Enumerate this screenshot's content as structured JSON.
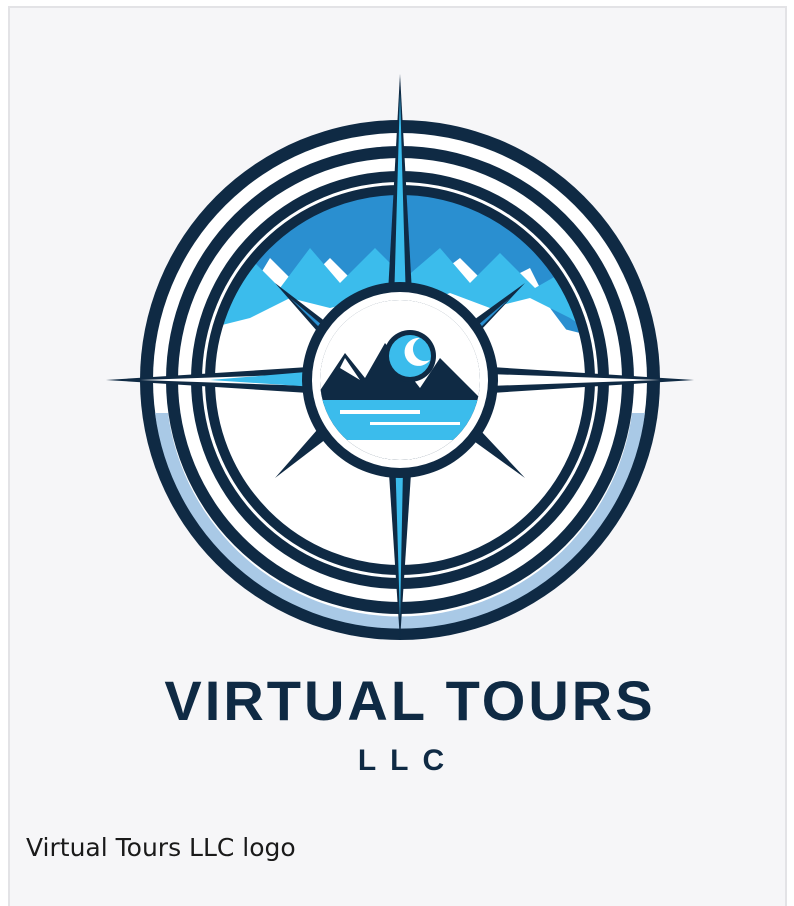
{
  "logo": {
    "name_line1": "VIRTUAL TOURS",
    "name_line2": "LLC",
    "colors": {
      "navy": "#0f2a44",
      "sky": "#3bbcec",
      "blue": "#2a8fd0",
      "light_blue": "#a9c9e6",
      "white": "#ffffff",
      "background": "#f6f6f8"
    },
    "icon": "compass-rose-icon"
  },
  "caption": {
    "text": "Virtual Tours LLC logo"
  }
}
